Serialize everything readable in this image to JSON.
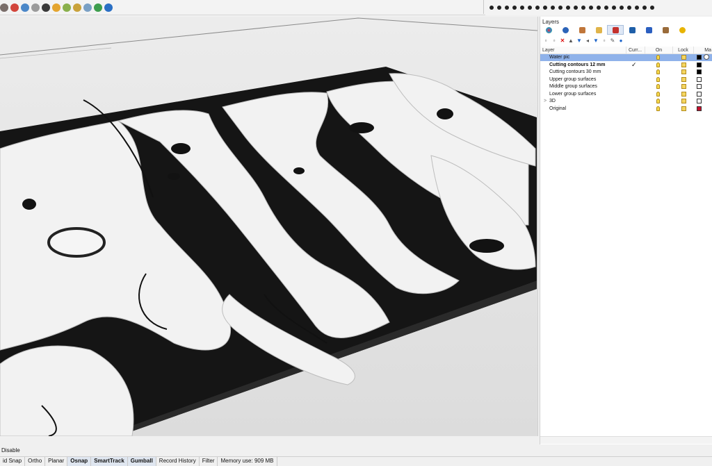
{
  "toolbar": {
    "icons": [
      "shade-icon",
      "color-wheel-icon",
      "render-icon",
      "sphere-icon",
      "display-mode-icon",
      "sun-icon",
      "environment-icon",
      "gear-icon",
      "plugin-icon",
      "globe-icon",
      "help-icon"
    ]
  },
  "panel": {
    "title": "Layers",
    "tabs": [
      "properties-tab",
      "render-tab",
      "brush-tab",
      "folder-tab",
      "layers-tab",
      "display-tab",
      "notification-tab",
      "notes-tab",
      "help-tab"
    ],
    "columns": {
      "layer": "Layer",
      "current": "Curr...",
      "on": "On",
      "lock": "Lock",
      "material": "Ma"
    },
    "layers": [
      {
        "name": "Water pic",
        "selected": true,
        "current": false,
        "bold": false,
        "expand": "",
        "color": "#000000"
      },
      {
        "name": "Cutting contours 12 mm",
        "selected": false,
        "current": true,
        "bold": true,
        "expand": "",
        "color": "#000000"
      },
      {
        "name": "Cutting contours 30 mm",
        "selected": false,
        "current": false,
        "bold": false,
        "expand": "",
        "color": "#000000"
      },
      {
        "name": "Upper group surfaces",
        "selected": false,
        "current": false,
        "bold": false,
        "expand": "",
        "color": "#ffffff"
      },
      {
        "name": "Middle group surfaces",
        "selected": false,
        "current": false,
        "bold": false,
        "expand": "",
        "color": "#ffffff"
      },
      {
        "name": "Lower group surfaces",
        "selected": false,
        "current": false,
        "bold": false,
        "expand": "",
        "color": "#ffffff"
      },
      {
        "name": "3D",
        "selected": false,
        "current": false,
        "bold": false,
        "expand": ">",
        "color": "#ffffff"
      },
      {
        "name": "Original",
        "selected": false,
        "current": false,
        "bold": false,
        "expand": "",
        "color": "#c8102e"
      }
    ]
  },
  "command": {
    "text": "Disable"
  },
  "status": {
    "items": [
      {
        "label": "id Snap",
        "bold": false
      },
      {
        "label": "Ortho",
        "bold": false
      },
      {
        "label": "Planar",
        "bold": false
      },
      {
        "label": "Osnap",
        "bold": true
      },
      {
        "label": "SmartTrack",
        "bold": true
      },
      {
        "label": "Gumball",
        "bold": true
      },
      {
        "label": "Record History",
        "bold": false
      },
      {
        "label": "Filter",
        "bold": false
      },
      {
        "label": "Memory use: 909 MB",
        "bold": false
      }
    ]
  }
}
